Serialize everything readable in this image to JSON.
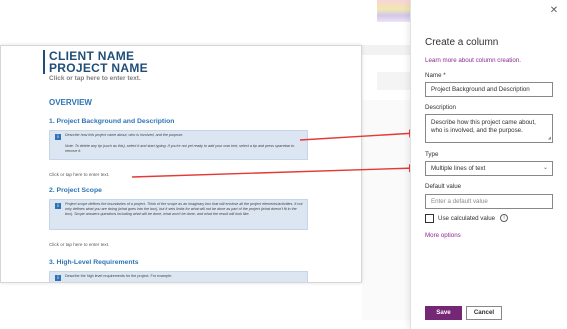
{
  "document": {
    "title_line1": "CLIENT NAME",
    "title_line2": "PROJECT NAME",
    "subtitle": "Click or tap here to enter text.",
    "overview_heading": "OVERVIEW",
    "sections": [
      {
        "heading": "1.  Project Background and Description",
        "note_main": "Describe how this project came about, who is involved, and the purpose.",
        "note_secondary": "Note: To delete any tip (such as this), select it and start typing. If you're not yet ready to add your own text, select a tip and press spacebar to remove it.",
        "placeholder": "Click or tap here to enter text."
      },
      {
        "heading": "2.  Project Scope",
        "note_main": "Project scope defines the boundaries of a project. Think of the scope as an imaginary box that will enclose all the project elements/activities. It not only defines what you are doing (what goes into the box), but it sets limits for what will not be done as part of the project (what doesn't fit in the box). Scope answers questions including what will be done, what won't be done, and what the result will look like.",
        "placeholder": "Click or tap here to enter text."
      },
      {
        "heading": "3.  High-Level Requirements",
        "note_main": "Describe the high level requirements for the project. For example:"
      }
    ]
  },
  "panel": {
    "title": "Create a column",
    "learn_link": "Learn more about column creation.",
    "name_label": "Name *",
    "name_value": "Project Background and Description",
    "description_label": "Description",
    "description_value": "Describe how this project came about, who is involved, and the purpose.",
    "type_label": "Type",
    "type_value": "Multiple lines of text",
    "default_label": "Default value",
    "default_placeholder": "Enter a default value",
    "calc_label": "Use calculated value",
    "more_options": "More options",
    "save_label": "Save",
    "cancel_label": "Cancel"
  },
  "icons": {
    "close": "close-icon",
    "chevron": "chevron-down-icon",
    "info": "info-icon",
    "note": "info-note-icon"
  },
  "colors": {
    "accent_purple": "#742774",
    "link_purple": "#8c2a91",
    "doc_blue": "#2e74b5",
    "doc_navy": "#1f4e79",
    "note_bg": "#dce6f2",
    "arrow_red": "#e53935"
  }
}
